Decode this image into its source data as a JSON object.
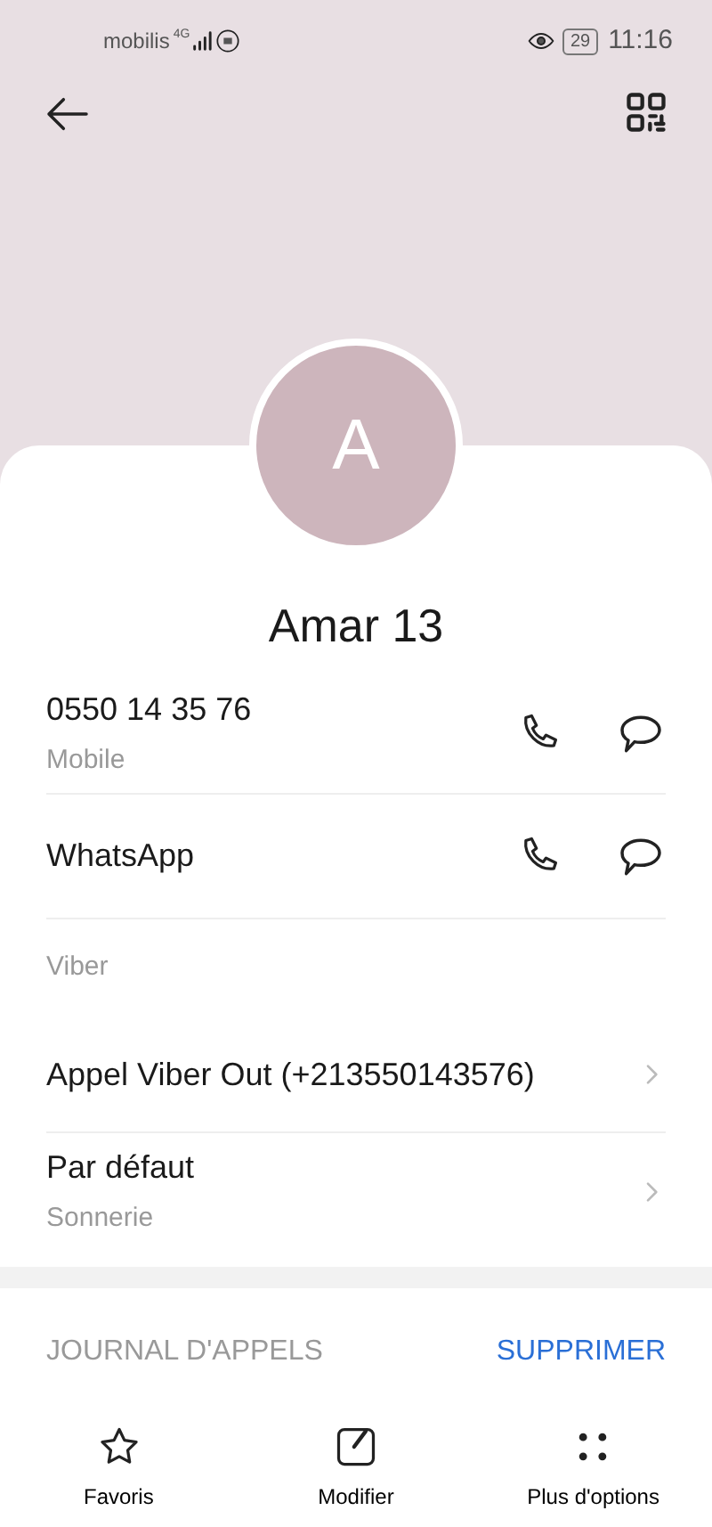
{
  "status_bar": {
    "carrier": "mobilis",
    "network": "4G",
    "battery": "29",
    "time": "11:16"
  },
  "contact": {
    "initial": "A",
    "name": "Amar 13"
  },
  "rows": [
    {
      "kind": "number",
      "title": "0550 14 35 76",
      "subtitle": "Mobile"
    },
    {
      "kind": "app",
      "title": "WhatsApp"
    },
    {
      "kind": "section",
      "title": "Viber"
    },
    {
      "kind": "link",
      "title": "Appel Viber Out (+213550143576)"
    },
    {
      "kind": "link",
      "title": "Par défaut",
      "subtitle": "Sonnerie"
    }
  ],
  "call_log": {
    "title": "JOURNAL D'APPELS",
    "action": "SUPPRIMER"
  },
  "bottom_bar": [
    {
      "kind": "star",
      "label": "Favoris"
    },
    {
      "kind": "edit",
      "label": "Modifier"
    },
    {
      "kind": "more",
      "label": "Plus d'options"
    }
  ]
}
